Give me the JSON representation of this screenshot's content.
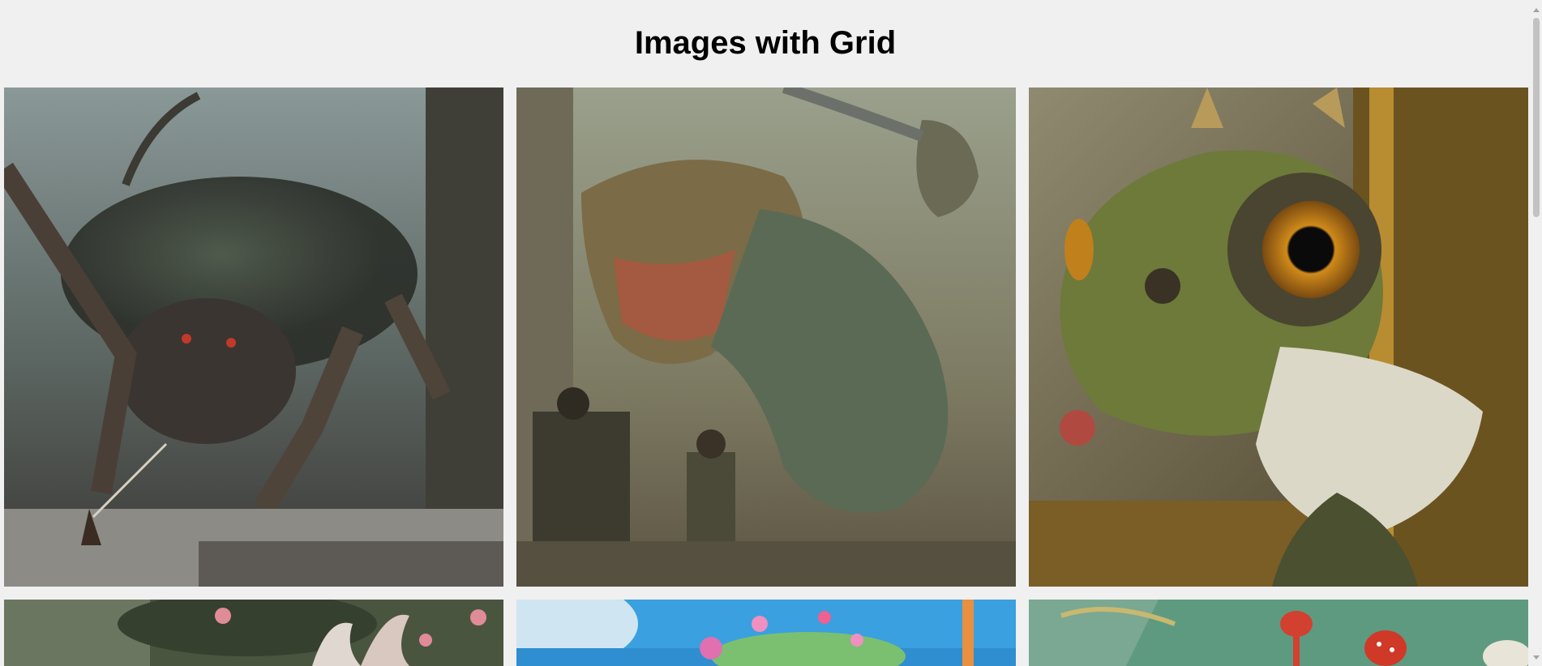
{
  "page": {
    "title": "Images with Grid"
  },
  "grid": {
    "tiles": [
      {
        "name": "giant-spider-image",
        "row": 1,
        "col": 1
      },
      {
        "name": "dinosaur-attack-image",
        "row": 1,
        "col": 2
      },
      {
        "name": "chameleon-portrait-image",
        "row": 1,
        "col": 3
      },
      {
        "name": "fantasy-forest-image",
        "row": 2,
        "col": 1
      },
      {
        "name": "candy-island-image",
        "row": 2,
        "col": 2
      },
      {
        "name": "mushroom-garden-image",
        "row": 2,
        "col": 3
      }
    ]
  },
  "colors": {
    "background": "#f0f0f0",
    "title": "#000000",
    "scrollbar_thumb": "#c2c2c2"
  }
}
